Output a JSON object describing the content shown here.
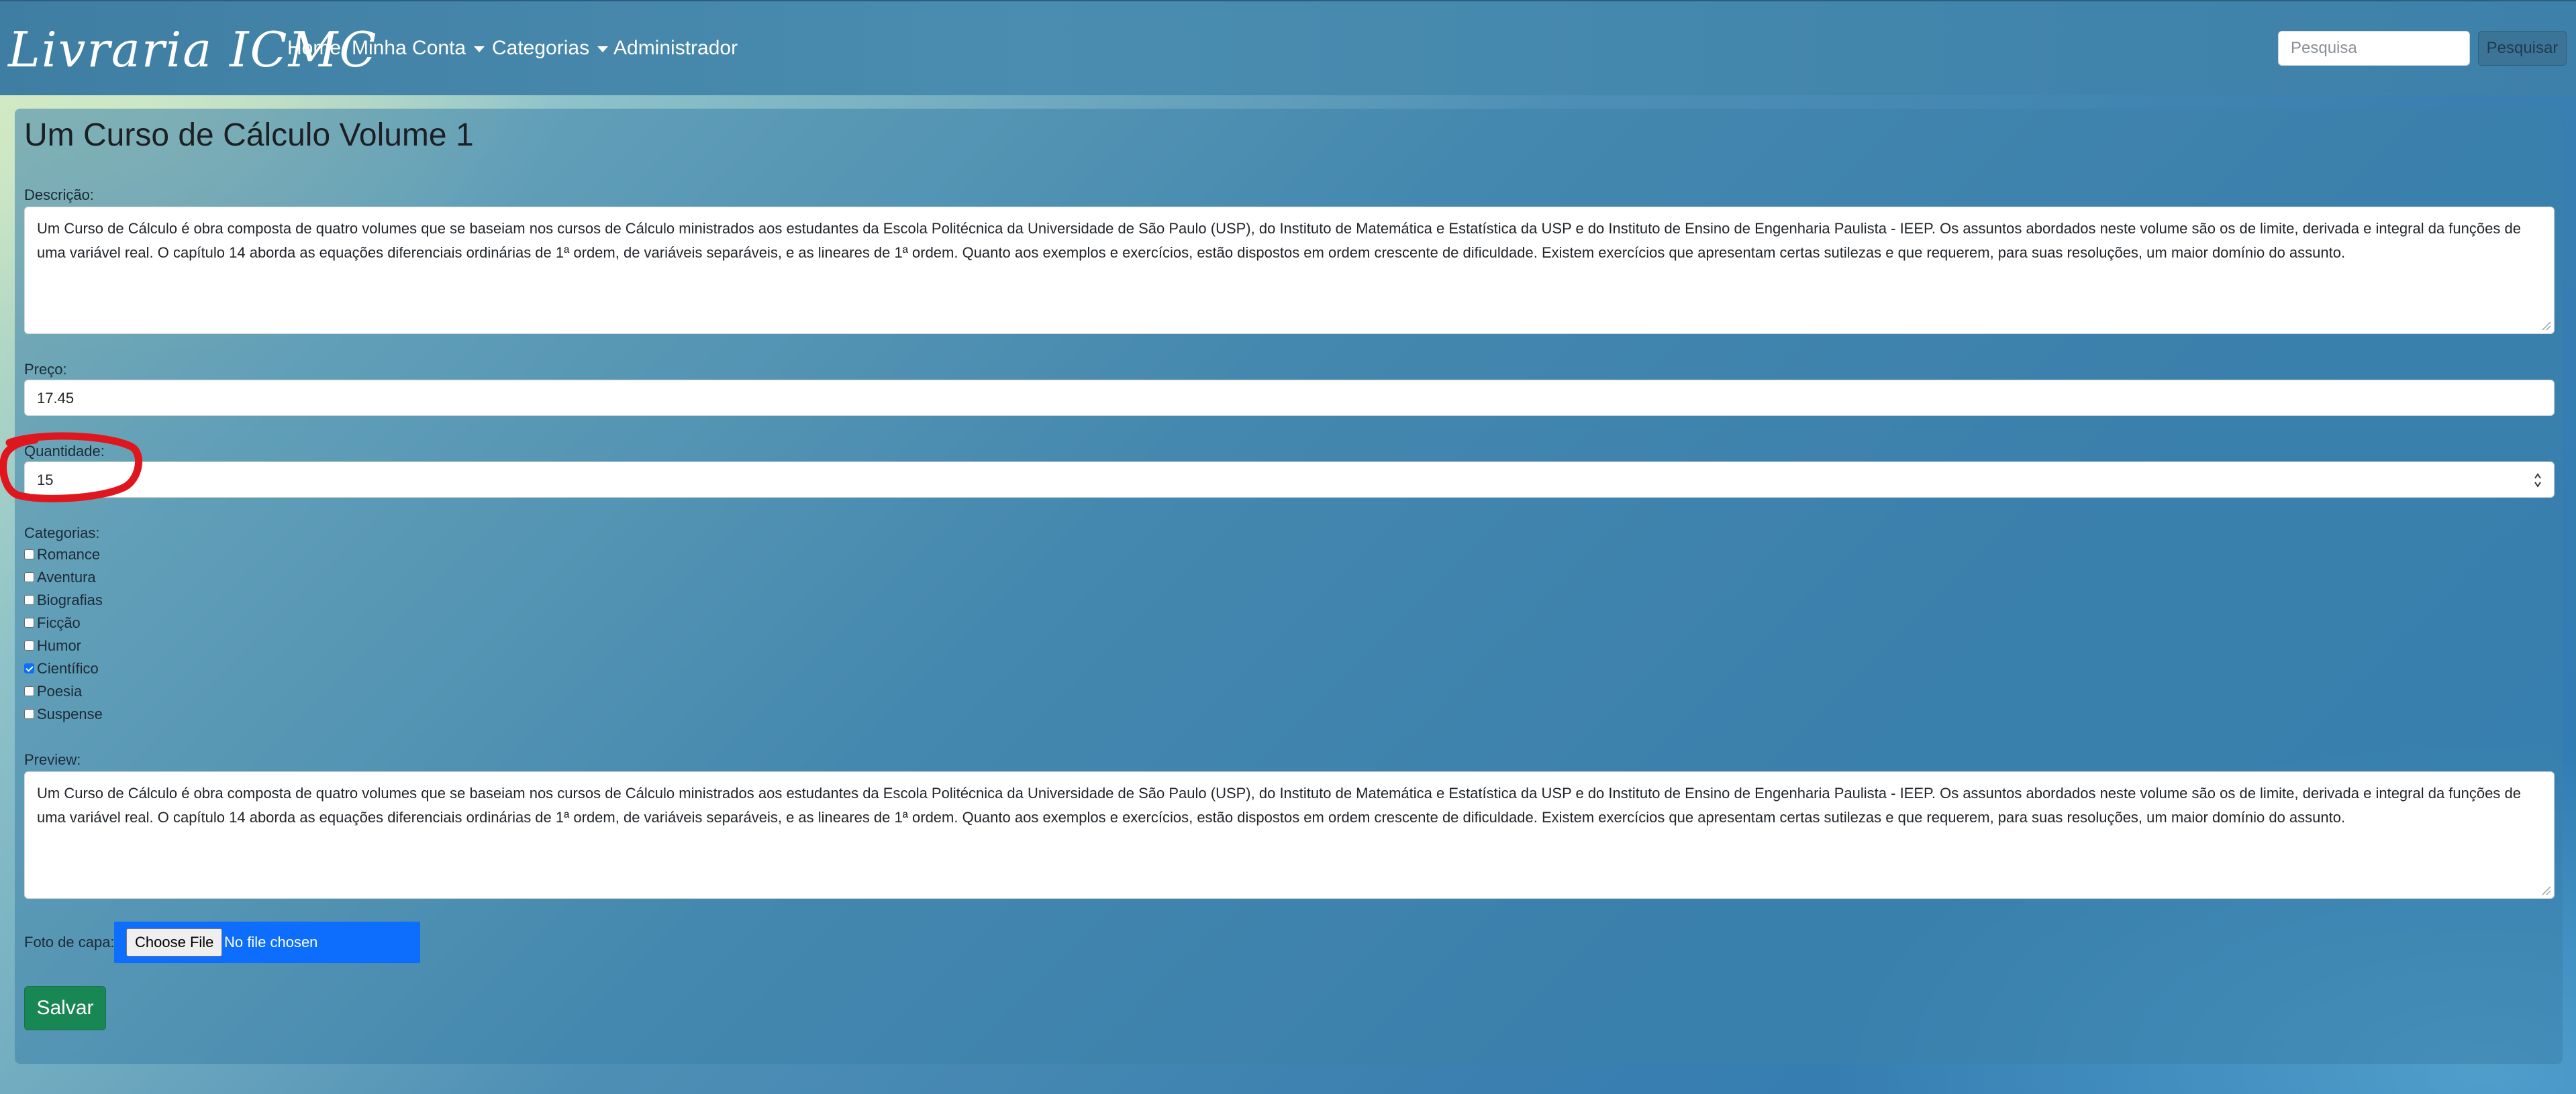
{
  "navbar": {
    "brand": "Livraria ICMC",
    "links": [
      "Home",
      "Minha Conta",
      "Categorias",
      "Administrador"
    ],
    "search_placeholder": "Pesquisa",
    "search_button": "Pesquisar"
  },
  "form": {
    "title": "Um Curso de Cálculo Volume 1",
    "descricao_label": "Descrição:",
    "descricao_value": "Um Curso de Cálculo é obra composta de quatro volumes que se baseiam nos cursos de Cálculo ministrados aos estudantes da Escola Politécnica da Universidade de São Paulo (USP), do Instituto de Matemática e Estatística da USP e do Instituto de Ensino de Engenharia Paulista - IEEP. Os assuntos abordados neste volume são os de limite, derivada e integral da funções de uma variável real. O capítulo 14 aborda as equações diferenciais ordinárias de 1ª ordem, de variáveis separáveis, e as lineares de 1ª ordem. Quanto aos exemplos e exercícios, estão dispostos em ordem crescente de dificuldade. Existem exercícios que apresentam certas sutilezas e que requerem, para suas resoluções, um maior domínio do assunto.",
    "preco_label": "Preço:",
    "preco_value": "17.45",
    "quantidade_label": "Quantidade:",
    "quantidade_value": "15",
    "categorias_label": "Categorias:",
    "categorias": [
      {
        "label": "Romance",
        "checked": false
      },
      {
        "label": "Aventura",
        "checked": false
      },
      {
        "label": "Biografias",
        "checked": false
      },
      {
        "label": "Ficção",
        "checked": false
      },
      {
        "label": "Humor",
        "checked": false
      },
      {
        "label": "Científico",
        "checked": true
      },
      {
        "label": "Poesia",
        "checked": false
      },
      {
        "label": "Suspense",
        "checked": false
      }
    ],
    "preview_label": "Preview:",
    "preview_value": "Um Curso de Cálculo é obra composta de quatro volumes que se baseiam nos cursos de Cálculo ministrados aos estudantes da Escola Politécnica da Universidade de São Paulo (USP), do Instituto de Matemática e Estatística da USP e do Instituto de Ensino de Engenharia Paulista - IEEP. Os assuntos abordados neste volume são os de limite, derivada e integral da funções de uma variável real. O capítulo 14 aborda as equações diferenciais ordinárias de 1ª ordem, de variáveis separáveis, e as lineares de 1ª ordem. Quanto aos exemplos e exercícios, estão dispostos em ordem crescente de dificuldade. Existem exercícios que apresentam certas sutilezas e que requerem, para suas resoluções, um maior domínio do assunto.",
    "foto_label": "Foto de capa:",
    "file_button": "Choose File",
    "file_status": "No file chosen",
    "save_button": "Salvar"
  },
  "colors": {
    "annotation": "#e0161e",
    "save": "#198754",
    "file_box": "#0d6efd"
  }
}
